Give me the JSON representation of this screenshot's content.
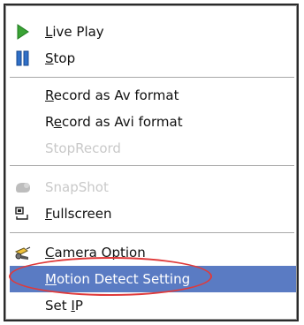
{
  "menu": {
    "items": [
      {
        "label": "Live Play",
        "mnemonic": "L",
        "rest": "ive Play",
        "icon": "play-icon",
        "enabled": true
      },
      {
        "label": "Stop",
        "mnemonic": "S",
        "rest": "top",
        "icon": "pause-icon",
        "enabled": true
      },
      {
        "label": "Record as Av format",
        "mnemonic": "R",
        "rest": "ecord as Av format",
        "enabled": true
      },
      {
        "label": "Record as Avi format",
        "prefix": "R",
        "mnemonic": "e",
        "rest": "cord as Avi format",
        "enabled": true
      },
      {
        "label": "StopRecord",
        "enabled": false
      },
      {
        "label": "SnapShot",
        "icon": "camera-icon",
        "enabled": false
      },
      {
        "label": "Fullscreen",
        "mnemonic": "F",
        "rest": "ullscreen",
        "icon": "fullscreen-icon",
        "enabled": true
      },
      {
        "label": "Camera Option",
        "mnemonic": "C",
        "rest": "amera Option",
        "icon": "camera-option-icon",
        "enabled": true
      },
      {
        "label": "Motion Detect Setting",
        "mnemonic": "M",
        "rest": "otion Detect Setting",
        "enabled": true,
        "selected": true
      },
      {
        "label": "Set IP",
        "prefix": "Set ",
        "mnemonic": "I",
        "rest": "P",
        "enabled": true
      }
    ]
  },
  "colors": {
    "selection": "#5a7bc3",
    "highlight_ellipse": "#e03a3a",
    "disabled_text": "#c9c9c9",
    "play_icon": "#3aa335",
    "stop_icon": "#2f6fc7"
  }
}
